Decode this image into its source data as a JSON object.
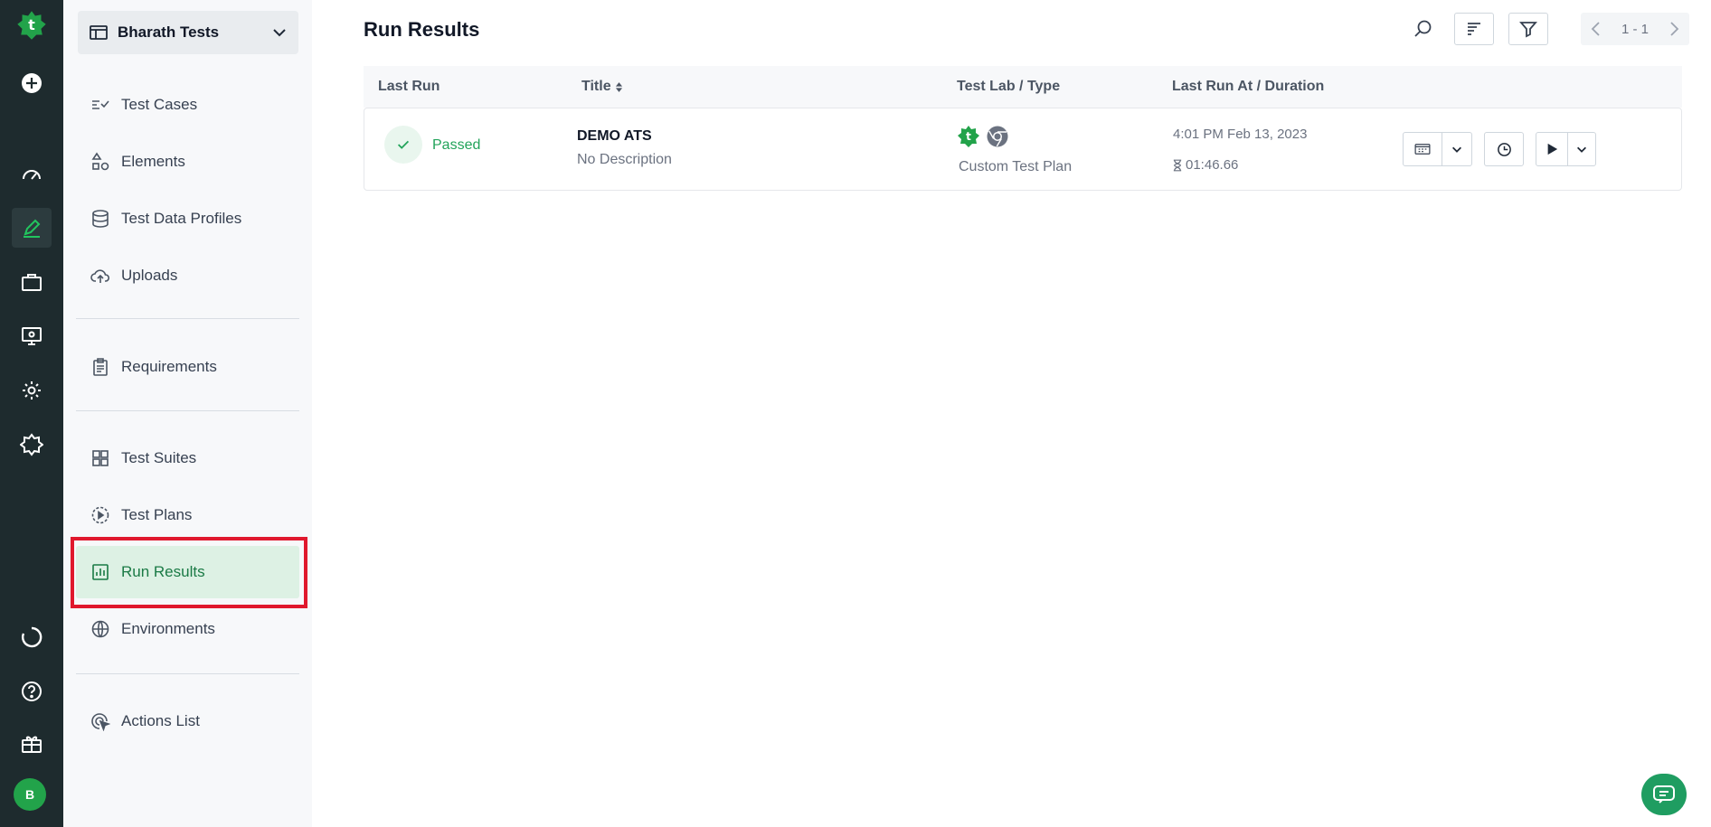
{
  "rail": {
    "avatar_initial": "B",
    "brand_color": "#22a34a"
  },
  "sidebar": {
    "workspace": "Bharath Tests",
    "items": [
      {
        "label": "Test Cases",
        "icon": "checklist-icon"
      },
      {
        "label": "Elements",
        "icon": "shapes-icon"
      },
      {
        "label": "Test Data Profiles",
        "icon": "database-icon"
      },
      {
        "label": "Uploads",
        "icon": "cloud-upload-icon"
      },
      {
        "label": "Requirements",
        "icon": "clipboard-icon"
      },
      {
        "label": "Test Suites",
        "icon": "grid-icon"
      },
      {
        "label": "Test Plans",
        "icon": "play-circle-icon"
      },
      {
        "label": "Run Results",
        "icon": "bar-chart-icon",
        "active": true
      },
      {
        "label": "Environments",
        "icon": "globe-icon"
      },
      {
        "label": "Actions List",
        "icon": "cursor-click-icon"
      }
    ]
  },
  "main": {
    "title": "Run Results",
    "pager": "1 - 1",
    "columns": {
      "last_run": "Last Run",
      "title": "Title",
      "test_lab": "Test Lab / Type",
      "last_run_at": "Last Run At / Duration"
    },
    "rows": [
      {
        "status": "Passed",
        "title": "DEMO ATS",
        "description": "No Description",
        "type": "Custom Test Plan",
        "run_at": "4:01 PM Feb 13, 2023",
        "duration": "01:46.66"
      }
    ]
  },
  "colors": {
    "accent": "#1f9d61",
    "highlight": "#e0182d",
    "active_bg": "#ddf1e4"
  }
}
